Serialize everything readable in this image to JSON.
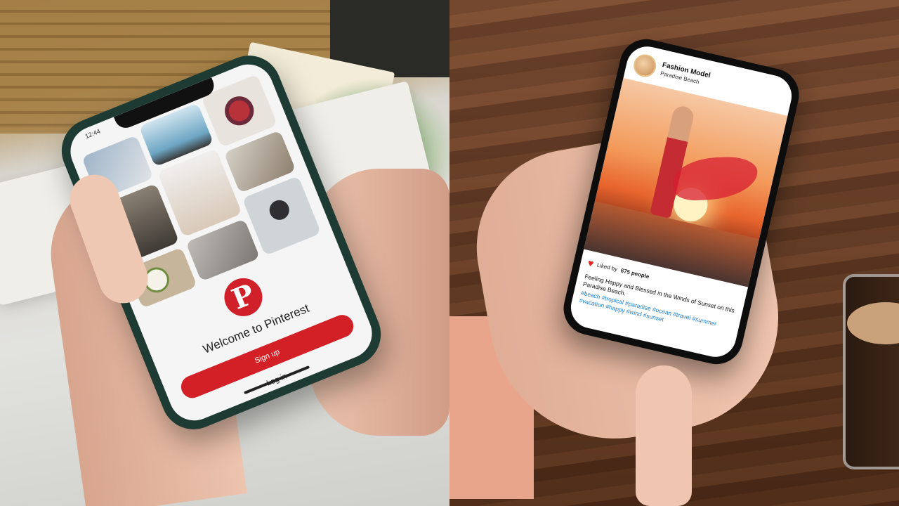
{
  "left_phone": {
    "status_time": "12:44",
    "pinterest_logo": "P",
    "welcome_text": "Welcome to Pinterest",
    "signup_label": "Sign up",
    "login_label": "Log in",
    "brand_color": "#d32027"
  },
  "right_phone": {
    "username": "Fashion Model",
    "location": "Paradise Beach",
    "liked_prefix": "Liked by",
    "liked_count": "675 people",
    "caption": "Feeling Happy and Blessed in the Winds of Sunset on this Paradise Beach.",
    "hashtags": "#beach #tropical #paradise #ocean #travel #summer #vacation #happy #wind #sunset",
    "hashtag_color": "#1e7fd0",
    "heart_icon": "heart-icon"
  }
}
